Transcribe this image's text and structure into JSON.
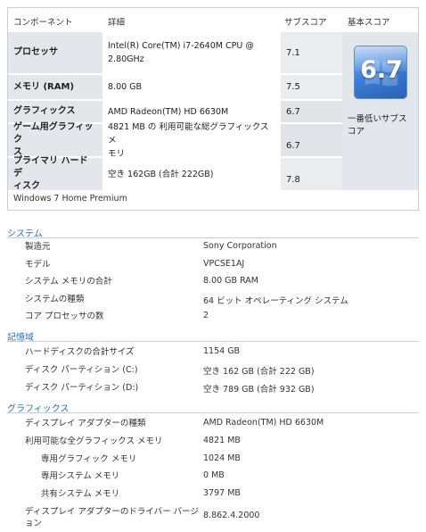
{
  "score_table": {
    "headers": {
      "component": "コンポーネント",
      "detail": "詳細",
      "subscore": "サブスコア",
      "base_score": "基本スコア"
    },
    "rows": [
      {
        "name": "プロセッサ",
        "detail_line1": "Intel(R) Core(TM) i7-2640M CPU @",
        "detail_line2": "2.80GHz",
        "subscore": "7.1"
      },
      {
        "name": "メモリ (RAM)",
        "detail_line1": "8.00 GB",
        "subscore": "7.5"
      },
      {
        "name": "グラフィックス",
        "detail_line1": "AMD Radeon(TM) HD 6630M",
        "subscore": "6.7"
      },
      {
        "name_line1": "ゲーム用グラフィック",
        "name_line2": "ス",
        "detail_line1": "4821 MB の 利用可能な総グラフィックス メ",
        "detail_line2": "モリ",
        "subscore": "6.7"
      },
      {
        "name_line1": "プライマリ ハード デ",
        "name_line2": "ィスク",
        "detail_line1": "空き 162GB (合計 222GB)",
        "subscore": "7.8"
      }
    ],
    "base_score": "6.7",
    "base_note_line1": "一番低いサブス",
    "base_note_line2": "コア",
    "edition": "Windows 7 Home Premium"
  },
  "sections": {
    "system": {
      "title": "システム",
      "items": [
        {
          "label": "製造元",
          "value": "Sony Corporation"
        },
        {
          "label": "モデル",
          "value": "VPCSE1AJ"
        },
        {
          "label": "システム メモリの合計",
          "value": "8.00 GB RAM"
        },
        {
          "label": "システムの種類",
          "value": "64 ビット オペレーティング システム"
        },
        {
          "label": "コア プロセッサの数",
          "value": "2"
        }
      ]
    },
    "storage": {
      "title": "記憶域",
      "items": [
        {
          "label": "ハードディスクの合計サイズ",
          "value": "1154 GB"
        },
        {
          "label": "ディスク パーティション (C:)",
          "value": "空き 162 GB (合計 222 GB)"
        },
        {
          "label": "ディスク パーティション (D:)",
          "value": "空き 789 GB (合計 932 GB)"
        }
      ]
    },
    "graphics": {
      "title": "グラフィックス",
      "items": [
        {
          "label": "ディスプレイ アダプターの種類",
          "value": "AMD Radeon(TM) HD 6630M"
        },
        {
          "label": "利用可能な全グラフィックス メモリ",
          "value": "4821 MB"
        },
        {
          "label": "専用グラフィック メモリ",
          "value": "1024 MB"
        },
        {
          "label": "専用システム メモリ",
          "value": "0 MB"
        },
        {
          "label": "共有システム メモリ",
          "value": "3797 MB"
        },
        {
          "label_line1": "ディスプレイ アダプターのドライバー バージ",
          "label_line2": "ョン",
          "value": "8.862.4.2000"
        }
      ]
    }
  },
  "colors": {
    "section_title": "#2f6fb5",
    "row_header_bg": "#e3e6ea",
    "badge_blue": "#3b7fd6"
  },
  "icons": {
    "base_score_badge": "windows-logo-icon"
  }
}
